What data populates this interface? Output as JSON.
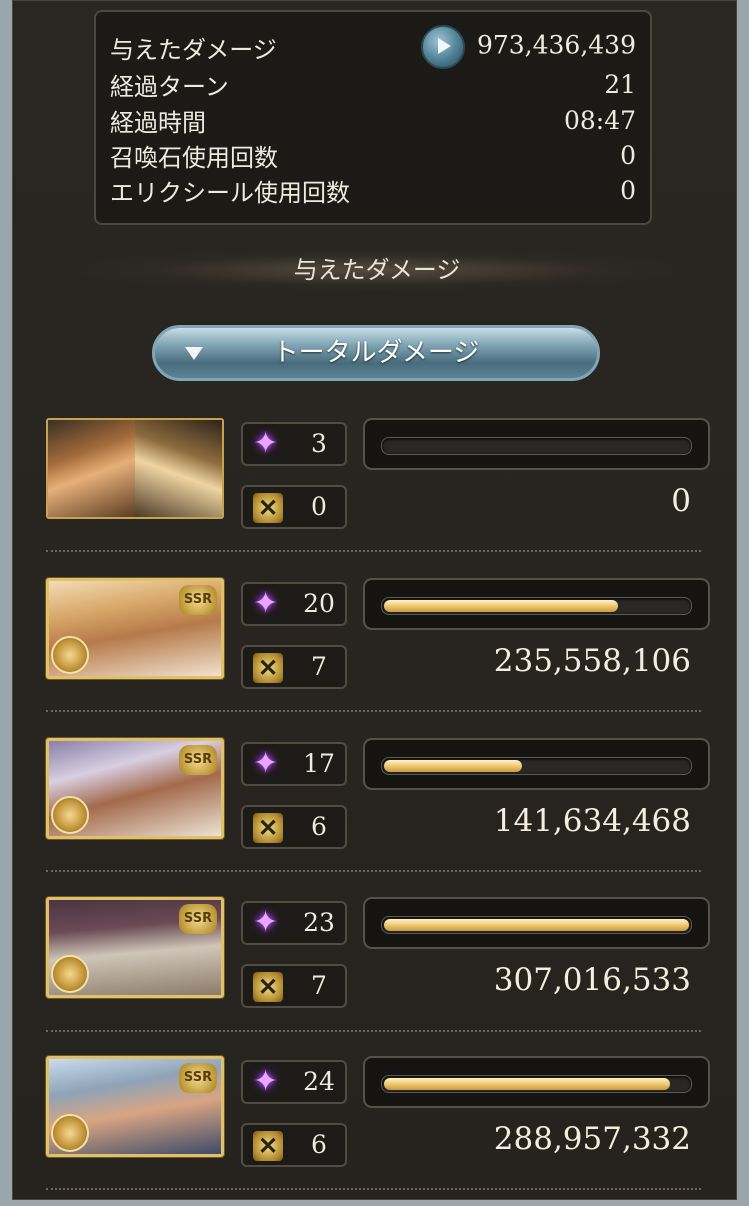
{
  "summary": {
    "damage_label": "与えたダメージ",
    "damage_value": "973,436,439",
    "turns_label": "経過ターン",
    "turns_value": "21",
    "time_label": "経過時間",
    "time_value": "08:47",
    "summons_label": "召喚石使用回数",
    "summons_value": "0",
    "elixir_label": "エリクシール使用回数",
    "elixir_value": "0"
  },
  "section_title": "与えたダメージ",
  "dropdown": {
    "label": "トータルダメージ"
  },
  "characters": [
    {
      "portrait": "Main character portrait pair",
      "rarity": "",
      "ability_count": "3",
      "ougi_count": "0",
      "damage": "0",
      "damage_fraction": 0.0
    },
    {
      "portrait": "Character portrait",
      "rarity": "SSR",
      "ability_count": "20",
      "ougi_count": "7",
      "damage": "235,558,106",
      "damage_fraction": 0.77
    },
    {
      "portrait": "Character portrait",
      "rarity": "SSR",
      "ability_count": "17",
      "ougi_count": "6",
      "damage": "141,634,468",
      "damage_fraction": 0.46
    },
    {
      "portrait": "Character portrait",
      "rarity": "SSR",
      "ability_count": "23",
      "ougi_count": "7",
      "damage": "307,016,533",
      "damage_fraction": 1.0
    },
    {
      "portrait": "Character portrait",
      "rarity": "SSR",
      "ability_count": "24",
      "ougi_count": "6",
      "damage": "288,957,332",
      "damage_fraction": 0.94
    }
  ],
  "colors": {
    "background": "#26231f",
    "bar_fill": "#f1cd7a",
    "dropdown": "#6f97a7",
    "text": "#f3eedd"
  }
}
